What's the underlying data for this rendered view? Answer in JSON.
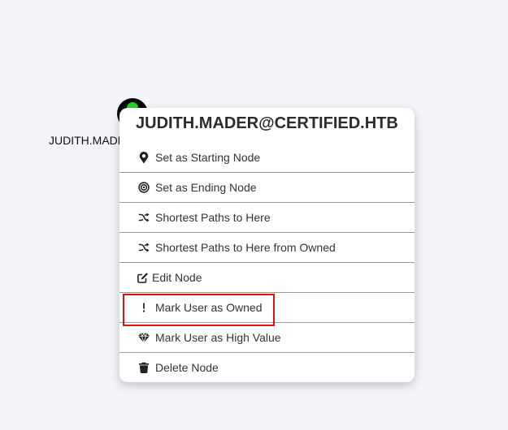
{
  "node": {
    "label": "JUDITH.MADER@CERTIFIED.HTB",
    "icon": "user-icon",
    "status_color": "#26d426"
  },
  "menu": {
    "title": "JUDITH.MADER@CERTIFIED.HTB",
    "items": [
      {
        "label": "Set as Starting Node",
        "icon": "map-pin-icon"
      },
      {
        "label": "Set as Ending Node",
        "icon": "target-icon"
      },
      {
        "label": "Shortest Paths to Here",
        "icon": "shuffle-icon"
      },
      {
        "label": "Shortest Paths to Here from Owned",
        "icon": "shuffle-icon"
      },
      {
        "label": "Edit Node",
        "icon": "edit-icon"
      },
      {
        "label": "Mark User as Owned",
        "icon": "exclamation-icon"
      },
      {
        "label": "Mark User as High Value",
        "icon": "gem-icon"
      },
      {
        "label": "Delete Node",
        "icon": "trash-icon"
      }
    ]
  },
  "highlight": {
    "color": "#e01010",
    "target": "Mark User as Owned"
  }
}
